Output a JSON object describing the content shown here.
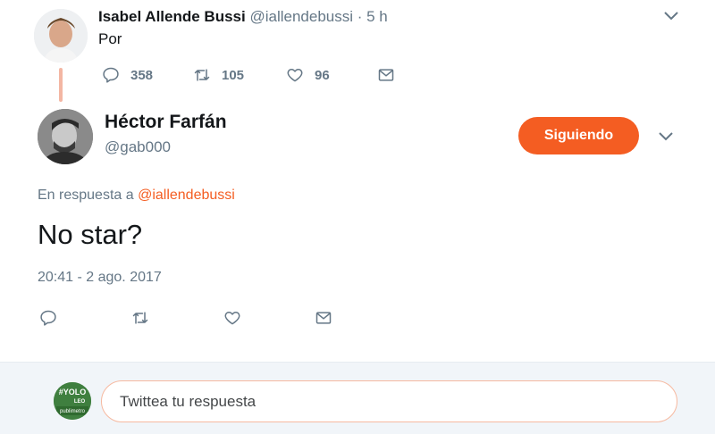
{
  "parent_tweet": {
    "author_name": "Isabel Allende Bussi",
    "author_handle": "@iallendebussi",
    "time": "· 5 h",
    "text": "Por",
    "actions": {
      "reply_count": "358",
      "retweet_count": "105",
      "like_count": "96"
    }
  },
  "main_tweet": {
    "author_name": "Héctor Farfán",
    "author_handle": "@gab000",
    "follow_label": "Siguiendo",
    "reply_context_prefix": "En respuesta a",
    "reply_context_mention": "@iallendebussi",
    "text": "No star?",
    "timestamp": "20:41 - 2 ago. 2017"
  },
  "reply_box": {
    "placeholder": "Twittea tu respuesta",
    "avatar_text": "#YOLO LEO publimetro"
  },
  "colors": {
    "accent": "#f45d22",
    "muted": "#657786",
    "text": "#14171a",
    "thread_line": "#f3b6a3",
    "reply_bar_bg": "#f1f5f9"
  },
  "icons": {
    "reply": "reply-icon",
    "retweet": "retweet-icon",
    "like": "heart-icon",
    "dm": "envelope-icon",
    "menu": "chevron-down-icon"
  }
}
